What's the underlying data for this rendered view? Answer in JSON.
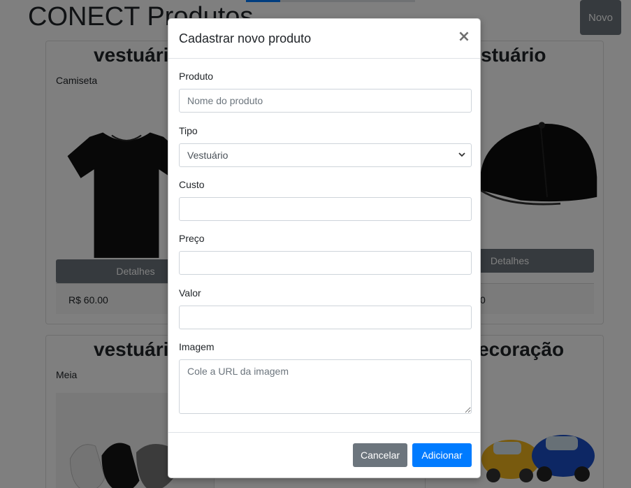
{
  "page": {
    "title": "CONECT Produtos",
    "new_button": "Novo"
  },
  "cards": [
    {
      "category": "vestuário",
      "name": "Camiseta",
      "details_label": "Detalhes",
      "price": "R$ 60.00"
    },
    {
      "category": "vestuário",
      "details_label": "Detalhes",
      "price_fragment": "0"
    },
    {
      "category": "vestuário",
      "name": "Meia"
    },
    {
      "category": "decoração"
    }
  ],
  "modal": {
    "title": "Cadastrar novo produto",
    "close_symbol": "×",
    "fields": {
      "produto": {
        "label": "Produto",
        "placeholder": "Nome do produto"
      },
      "tipo": {
        "label": "Tipo",
        "selected": "Vestuário"
      },
      "custo": {
        "label": "Custo"
      },
      "preco": {
        "label": "Preço"
      },
      "valor": {
        "label": "Valor"
      },
      "imagem": {
        "label": "Imagem",
        "placeholder": "Cole a URL da imagem"
      }
    },
    "buttons": {
      "cancel": "Cancelar",
      "add": "Adicionar"
    }
  },
  "icons": {
    "close": "close-icon",
    "select_arrow": "chevron-down-icon",
    "resize": "resize-grip-icon"
  },
  "colors": {
    "primary": "#007bff",
    "secondary": "#6c757d",
    "overlay": "rgba(0,0,0,0.5)"
  }
}
